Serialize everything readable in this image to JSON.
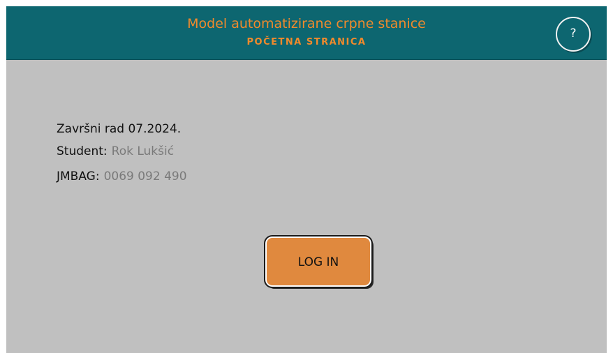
{
  "header": {
    "title": "Model automatizirane crpne stanice",
    "subtitle": "POČETNA STRANICA",
    "help_label": "?"
  },
  "info": {
    "thesis": "Završni rad 07.2024.",
    "student_label": "Student:",
    "student_value": "Rok Lukšić",
    "jmbag_label": "JMBAG:",
    "jmbag_value": "0069 092 490"
  },
  "login": {
    "label": "LOG IN"
  },
  "colors": {
    "header_bg": "#0d6670",
    "accent": "#f08a2c",
    "screen_bg": "#c0c0c0",
    "button_bg": "#e0893e",
    "value_text": "#7a7a7a"
  }
}
